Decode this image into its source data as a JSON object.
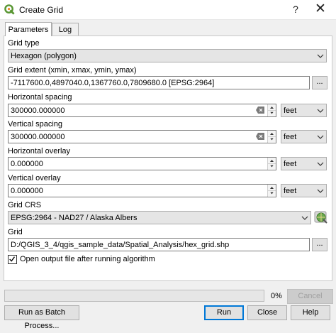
{
  "window": {
    "title": "Create Grid",
    "help_glyph": "?",
    "close_glyph": "✕"
  },
  "tabs": [
    {
      "label": "Parameters",
      "active": true
    },
    {
      "label": "Log",
      "active": false
    }
  ],
  "form": {
    "grid_type": {
      "label": "Grid type",
      "value": "Hexagon (polygon)"
    },
    "grid_extent": {
      "label": "Grid extent (xmin, xmax, ymin, ymax)",
      "value": "-7117600.0,4897040.0,1367760.0,7809680.0 [EPSG:2964]",
      "button": "..."
    },
    "horizontal_spacing": {
      "label": "Horizontal spacing",
      "value": "300000.000000",
      "unit": "feet"
    },
    "vertical_spacing": {
      "label": "Vertical spacing",
      "value": "300000.000000",
      "unit": "feet"
    },
    "horizontal_overlay": {
      "label": "Horizontal overlay",
      "value": "0.000000",
      "unit": "feet"
    },
    "vertical_overlay": {
      "label": "Vertical overlay",
      "value": "0.000000",
      "unit": "feet"
    },
    "grid_crs": {
      "label": "Grid CRS",
      "value": "EPSG:2964 - NAD27 / Alaska Albers"
    },
    "grid": {
      "label": "Grid",
      "value": "D:/QGIS_3_4/qgis_sample_data/Spatial_Analysis/hex_grid.shp",
      "button": "..."
    },
    "open_output": {
      "label": "Open output file after running algorithm",
      "checked": true
    }
  },
  "progress": {
    "percent_text": "0%",
    "value": 0
  },
  "buttons": {
    "cancel": "Cancel",
    "batch": "Run as Batch Process...",
    "run": "Run",
    "close": "Close",
    "help": "Help"
  },
  "colors": {
    "accent": "#0078d7",
    "qgis_green": "#589632",
    "qgis_yellow": "#ee7913"
  }
}
